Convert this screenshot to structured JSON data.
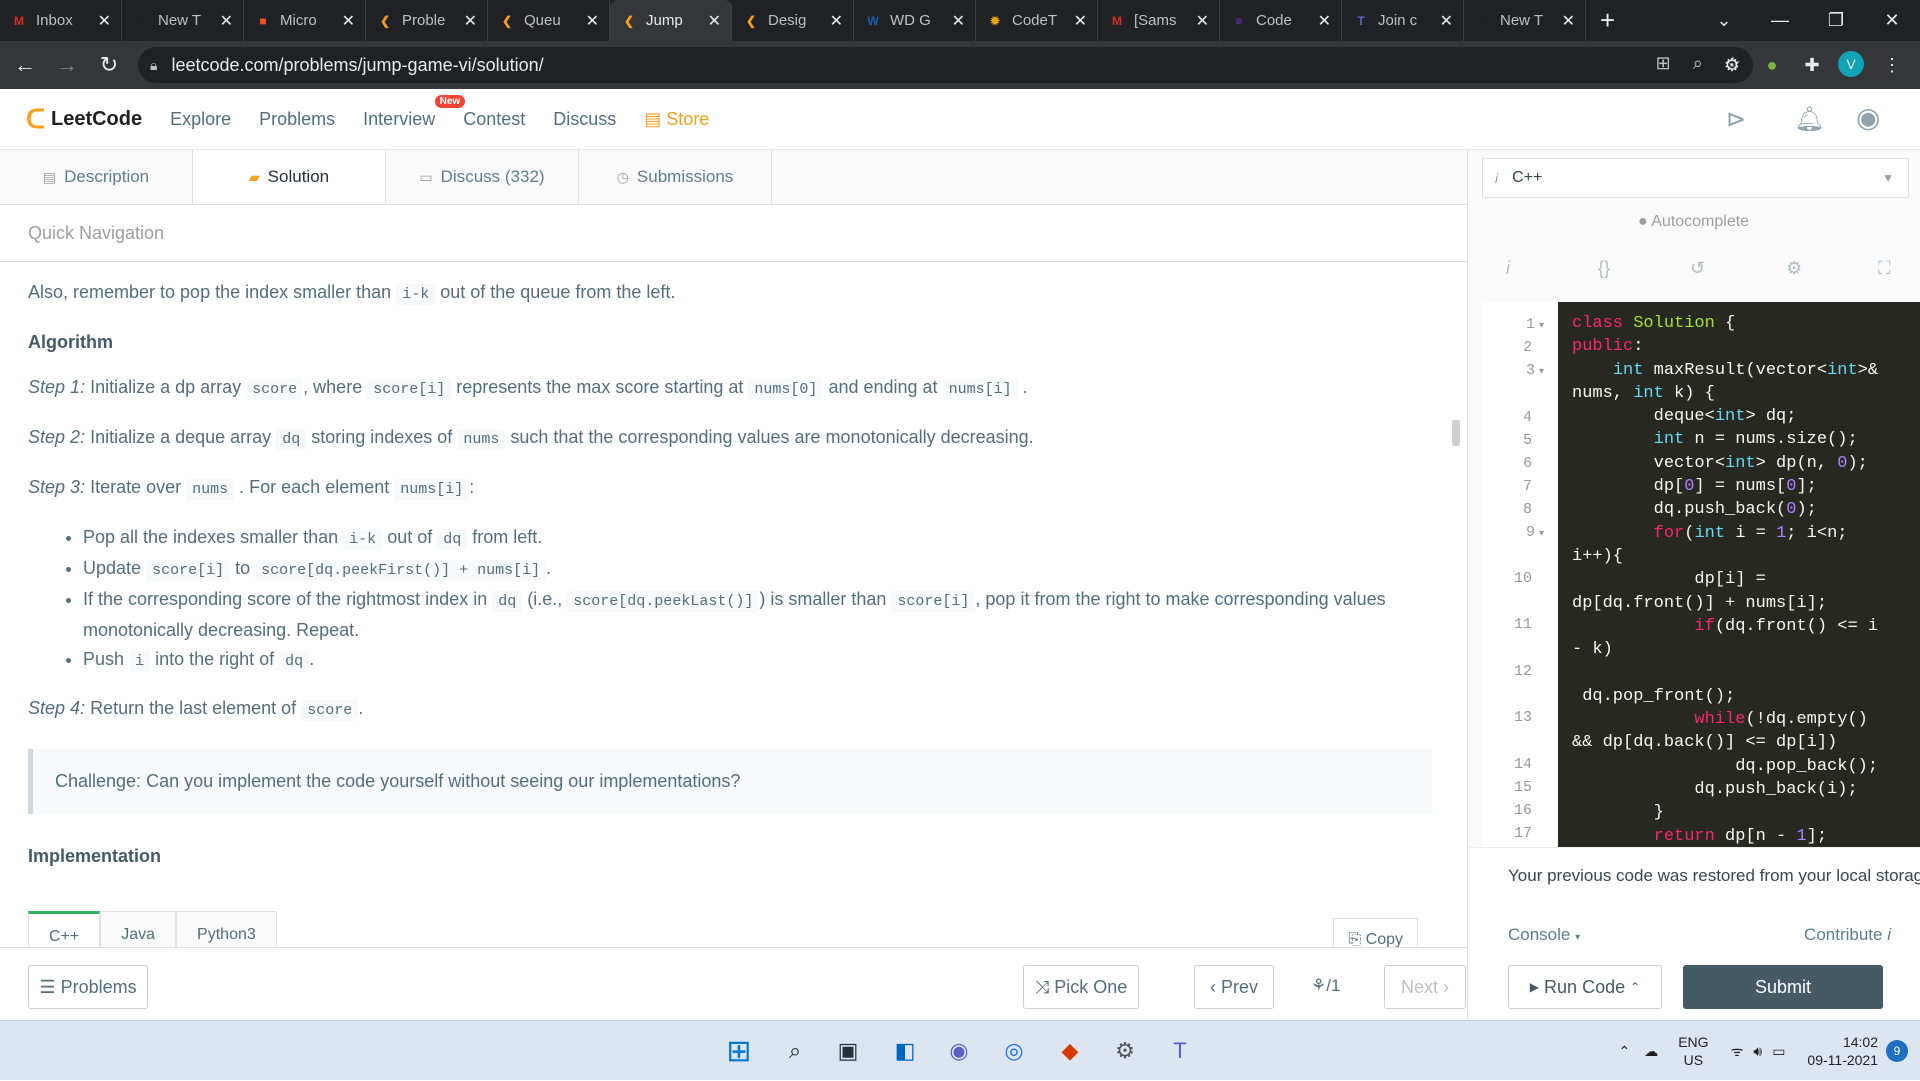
{
  "browser": {
    "tabs": [
      {
        "title": "Inbox",
        "icon": "gmail-icon",
        "color": "#d93025",
        "glyph": "M"
      },
      {
        "title": "New T",
        "icon": "github-icon",
        "color": "#202124",
        "glyph": "◉"
      },
      {
        "title": "Micro",
        "icon": "microsoft-icon",
        "color": "#f25022",
        "glyph": "■"
      },
      {
        "title": "Proble",
        "icon": "leetcode-icon",
        "color": "#f89f1b",
        "glyph": "❮"
      },
      {
        "title": "Queu",
        "icon": "leetcode-icon",
        "color": "#f89f1b",
        "glyph": "❮"
      },
      {
        "title": "Jump",
        "icon": "leetcode-icon",
        "color": "#f89f1b",
        "glyph": "❮"
      },
      {
        "title": "Desig",
        "icon": "leetcode-icon",
        "color": "#f89f1b",
        "glyph": "❮"
      },
      {
        "title": "WD G",
        "icon": "wd-icon",
        "color": "#1a5ea8",
        "glyph": "W"
      },
      {
        "title": "CodeT",
        "icon": "codetantra-icon",
        "color": "#e8a317",
        "glyph": "✹"
      },
      {
        "title": "[Sams",
        "icon": "gmail-icon",
        "color": "#d93025",
        "glyph": "M"
      },
      {
        "title": "Code",
        "icon": "form-icon",
        "color": "#673ab7",
        "glyph": "≡"
      },
      {
        "title": "Join c",
        "icon": "teams-icon",
        "color": "#5b5fc7",
        "glyph": "T"
      },
      {
        "title": "New T",
        "icon": "github-icon",
        "color": "#202124",
        "glyph": "◉"
      }
    ],
    "active_tab": 5,
    "url": "leetcode.com/problems/jump-game-vi/solution/",
    "profile_initial": "V"
  },
  "nav": {
    "logo": "LeetCode",
    "links": [
      "Explore",
      "Problems",
      "Interview",
      "Contest",
      "Discuss"
    ],
    "new_badge": "New",
    "store": "Store"
  },
  "tabs": [
    "Description",
    "Solution",
    "Discuss (332)",
    "Submissions"
  ],
  "quick_nav": "Quick Navigation",
  "article": {
    "line1_pre": "Also, remember to pop the index smaller than",
    "line1_code": "i-k",
    "line1_post": "out of the queue from the left.",
    "algorithm_heading": "Algorithm",
    "step1": {
      "label": "Step 1:",
      "t1": "Initialize a dp array",
      "c1": "score",
      "t2": ", where",
      "c2": "score[i]",
      "t3": "represents the max score starting at",
      "c3": "nums[0]",
      "t4": "and ending at",
      "c4": "nums[i]",
      "t5": "."
    },
    "step2": {
      "label": "Step 2:",
      "t1": "Initialize a deque array",
      "c1": "dq",
      "t2": "storing indexes of",
      "c2": "nums",
      "t3": "such that the corresponding values are monotonically decreasing."
    },
    "step3": {
      "label": "Step 3:",
      "t1": "Iterate over",
      "c1": "nums",
      "t2": ". For each element",
      "c2": "nums[i]",
      "t3": ":"
    },
    "bullets": {
      "b1": {
        "t1": "Pop all the indexes smaller than",
        "c1": "i-k",
        "t2": "out of",
        "c2": "dq",
        "t3": "from left."
      },
      "b2": {
        "t1": "Update",
        "c1": "score[i]",
        "t2": "to",
        "c2": "score[dq.peekFirst()] + nums[i]",
        "t3": "."
      },
      "b3": {
        "t1": "If the corresponding score of the rightmost index in",
        "c1": "dq",
        "t2": "(i.e.,",
        "c2": "score[dq.peekLast()]",
        "t3": ") is smaller than",
        "c3": "score[i]",
        "t4": ", pop it from the right to make corresponding values monotonically decreasing. Repeat."
      },
      "b4": {
        "t1": "Push",
        "c1": "i",
        "t2": "into the right of",
        "c2": "dq",
        "t3": "."
      }
    },
    "step4": {
      "label": "Step 4:",
      "t1": "Return the last element of",
      "c1": "score",
      "t2": "."
    },
    "challenge": "Challenge: Can you implement the code yourself without seeing our implementations?",
    "impl_heading": "Implementation",
    "lang_tabs": [
      "C++",
      "Java",
      "Python3"
    ],
    "copy": "Copy"
  },
  "bottom": {
    "problems": "Problems",
    "pick_one": "Pick One",
    "prev": "Prev",
    "page": "/1",
    "next": "Next"
  },
  "editor": {
    "language": "C++",
    "autocomplete": "Autocomplete",
    "line_numbers": [
      "1",
      "2",
      "3",
      "4",
      "5",
      "6",
      "7",
      "8",
      "9",
      "10",
      "11",
      "12",
      "13",
      "14",
      "15",
      "16",
      "17"
    ],
    "restored_msg": "Your previous code was restored from your local storage",
    "console": "Console",
    "contribute": "Contribute",
    "run_code": "Run Code",
    "submit": "Submit"
  },
  "taskbar": {
    "lang": "ENG",
    "region": "US",
    "time": "14:02",
    "date": "09-11-2021",
    "notif_count": "9"
  }
}
